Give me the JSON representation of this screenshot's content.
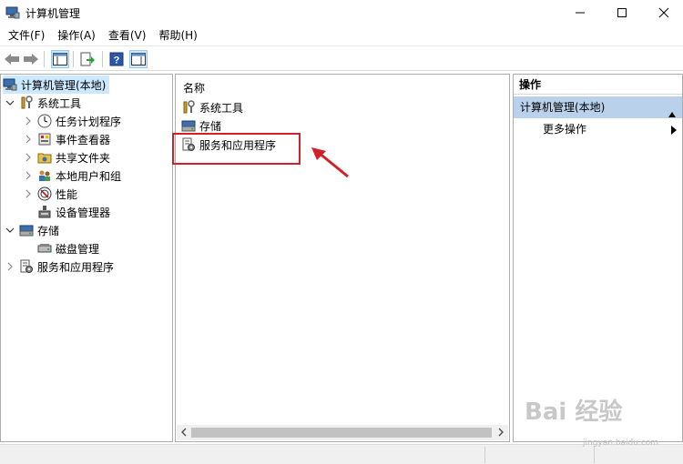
{
  "window": {
    "title": "计算机管理",
    "min_glyph": "—",
    "max_glyph": "☐",
    "close_glyph": "✕"
  },
  "menubar": {
    "items": [
      "文件(F)",
      "操作(A)",
      "查看(V)",
      "帮助(H)"
    ]
  },
  "tree": {
    "root": "计算机管理(本地)",
    "items": [
      {
        "label": "系统工具",
        "icon": "tools-icon"
      },
      {
        "label": "任务计划程序",
        "icon": "clock-icon"
      },
      {
        "label": "事件查看器",
        "icon": "event-viewer-icon"
      },
      {
        "label": "共享文件夹",
        "icon": "shared-folder-icon"
      },
      {
        "label": "本地用户和组",
        "icon": "users-icon"
      },
      {
        "label": "性能",
        "icon": "performance-icon"
      },
      {
        "label": "设备管理器",
        "icon": "device-manager-icon"
      },
      {
        "label": "存储",
        "icon": "storage-icon"
      },
      {
        "label": "磁盘管理",
        "icon": "disk-icon"
      },
      {
        "label": "服务和应用程序",
        "icon": "services-icon"
      }
    ]
  },
  "list": {
    "column_header": "名称",
    "items": [
      {
        "label": "系统工具",
        "icon": "tools-icon"
      },
      {
        "label": "存储",
        "icon": "storage-icon"
      },
      {
        "label": "服务和应用程序",
        "icon": "services-icon"
      }
    ]
  },
  "actions": {
    "header": "操作",
    "group": "计算机管理(本地)",
    "more": "更多操作"
  },
  "watermark": {
    "brand": "Bai 经验",
    "url": "jingyan.baidu.com"
  },
  "colors": {
    "selection": "#cce8ff",
    "actions_group": "#b9d1ea",
    "highlight_red": "#d0202a"
  }
}
